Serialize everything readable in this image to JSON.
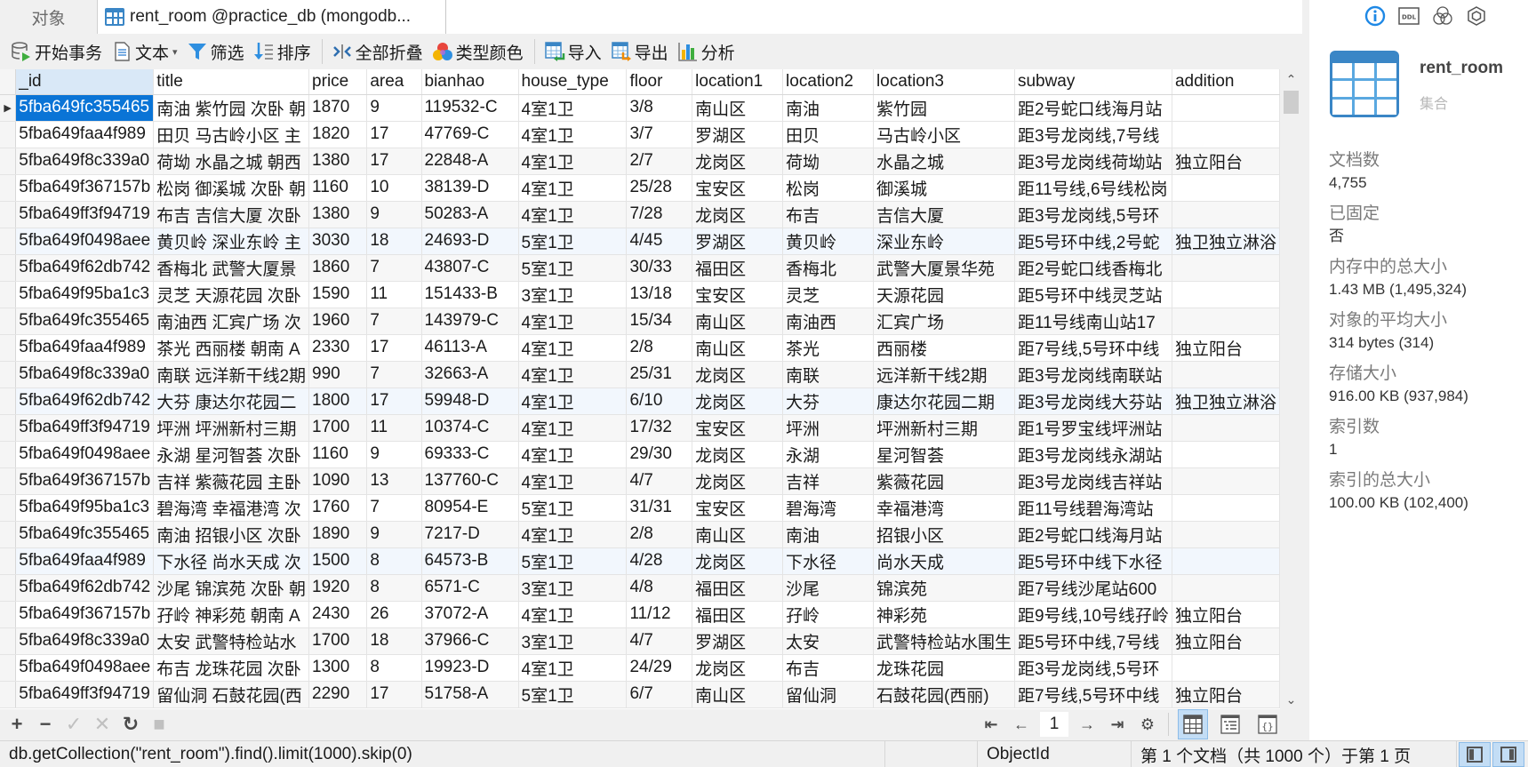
{
  "tabs": {
    "objects_label": "对象",
    "active_label": "rent_room @practice_db (mongodb..."
  },
  "toolbar": {
    "begin_transaction": "开始事务",
    "text": "文本",
    "filter": "筛选",
    "sort": "排序",
    "collapse_all": "全部折叠",
    "type_color": "类型颜色",
    "import": "导入",
    "export": "导出",
    "analyze": "分析"
  },
  "grid": {
    "columns": [
      "_id",
      "title",
      "price",
      "area",
      "bianhao",
      "house_type",
      "floor",
      "location1",
      "location2",
      "location3",
      "subway",
      "addition"
    ],
    "selected_row": 0,
    "rows": [
      [
        "5fba649fc355465",
        "南油 紫竹园 次卧 朝",
        "1870",
        "9",
        "119532-C",
        "4室1卫",
        "3/8",
        "南山区",
        "南油",
        "紫竹园",
        "距2号蛇口线海月站",
        ""
      ],
      [
        "5fba649faa4f989",
        "田贝 马古岭小区 主",
        "1820",
        "17",
        "47769-C",
        "4室1卫",
        "3/7",
        "罗湖区",
        "田贝",
        "马古岭小区",
        "距3号龙岗线,7号线",
        ""
      ],
      [
        "5fba649f8c339a0",
        "荷坳 水晶之城 朝西",
        "1380",
        "17",
        "22848-A",
        "4室1卫",
        "2/7",
        "龙岗区",
        "荷坳",
        "水晶之城",
        "距3号龙岗线荷坳站",
        "独立阳台"
      ],
      [
        "5fba649f367157b",
        "松岗 御溪城 次卧 朝",
        "1160",
        "10",
        "38139-D",
        "4室1卫",
        "25/28",
        "宝安区",
        "松岗",
        "御溪城",
        "距11号线,6号线松岗",
        ""
      ],
      [
        "5fba649ff3f94719",
        "布吉 吉信大厦 次卧",
        "1380",
        "9",
        "50283-A",
        "4室1卫",
        "7/28",
        "龙岗区",
        "布吉",
        "吉信大厦",
        "距3号龙岗线,5号环",
        ""
      ],
      [
        "5fba649f0498aee",
        "黄贝岭 深业东岭 主",
        "3030",
        "18",
        "24693-D",
        "5室1卫",
        "4/45",
        "罗湖区",
        "黄贝岭",
        "深业东岭",
        "距5号环中线,2号蛇",
        "独卫独立淋浴"
      ],
      [
        "5fba649f62db742",
        "香梅北 武警大厦景",
        "1860",
        "7",
        "43807-C",
        "5室1卫",
        "30/33",
        "福田区",
        "香梅北",
        "武警大厦景华苑",
        "距2号蛇口线香梅北",
        ""
      ],
      [
        "5fba649f95ba1c3",
        "灵芝 天源花园 次卧",
        "1590",
        "11",
        "151433-B",
        "3室1卫",
        "13/18",
        "宝安区",
        "灵芝",
        "天源花园",
        "距5号环中线灵芝站",
        ""
      ],
      [
        "5fba649fc355465",
        "南油西 汇宾广场 次",
        "1960",
        "7",
        "143979-C",
        "4室1卫",
        "15/34",
        "南山区",
        "南油西",
        "汇宾广场",
        "距11号线南山站17",
        ""
      ],
      [
        "5fba649faa4f989",
        "茶光 西丽楼 朝南 A",
        "2330",
        "17",
        "46113-A",
        "4室1卫",
        "2/8",
        "南山区",
        "茶光",
        "西丽楼",
        "距7号线,5号环中线",
        "独立阳台"
      ],
      [
        "5fba649f8c339a0",
        "南联 远洋新干线2期",
        "990",
        "7",
        "32663-A",
        "4室1卫",
        "25/31",
        "龙岗区",
        "南联",
        "远洋新干线2期",
        "距3号龙岗线南联站",
        ""
      ],
      [
        "5fba649f62db742",
        "大芬 康达尔花园二",
        "1800",
        "17",
        "59948-D",
        "4室1卫",
        "6/10",
        "龙岗区",
        "大芬",
        "康达尔花园二期",
        "距3号龙岗线大芬站",
        "独卫独立淋浴"
      ],
      [
        "5fba649ff3f94719",
        "坪洲 坪洲新村三期",
        "1700",
        "11",
        "10374-C",
        "4室1卫",
        "17/32",
        "宝安区",
        "坪洲",
        "坪洲新村三期",
        "距1号罗宝线坪洲站",
        ""
      ],
      [
        "5fba649f0498aee",
        "永湖 星河智荟 次卧",
        "1160",
        "9",
        "69333-C",
        "4室1卫",
        "29/30",
        "龙岗区",
        "永湖",
        "星河智荟",
        "距3号龙岗线永湖站",
        ""
      ],
      [
        "5fba649f367157b",
        "吉祥 紫薇花园 主卧",
        "1090",
        "13",
        "137760-C",
        "4室1卫",
        "4/7",
        "龙岗区",
        "吉祥",
        "紫薇花园",
        "距3号龙岗线吉祥站",
        ""
      ],
      [
        "5fba649f95ba1c3",
        "碧海湾 幸福港湾 次",
        "1760",
        "7",
        "80954-E",
        "5室1卫",
        "31/31",
        "宝安区",
        "碧海湾",
        "幸福港湾",
        "距11号线碧海湾站",
        ""
      ],
      [
        "5fba649fc355465",
        "南油 招银小区 次卧",
        "1890",
        "9",
        "7217-D",
        "4室1卫",
        "2/8",
        "南山区",
        "南油",
        "招银小区",
        "距2号蛇口线海月站",
        ""
      ],
      [
        "5fba649faa4f989",
        "下水径 尚水天成 次",
        "1500",
        "8",
        "64573-B",
        "5室1卫",
        "4/28",
        "龙岗区",
        "下水径",
        "尚水天成",
        "距5号环中线下水径",
        ""
      ],
      [
        "5fba649f62db742",
        "沙尾 锦滨苑 次卧 朝",
        "1920",
        "8",
        "6571-C",
        "3室1卫",
        "4/8",
        "福田区",
        "沙尾",
        "锦滨苑",
        "距7号线沙尾站600",
        ""
      ],
      [
        "5fba649f367157b",
        "孖岭 神彩苑 朝南 A",
        "2430",
        "26",
        "37072-A",
        "4室1卫",
        "11/12",
        "福田区",
        "孖岭",
        "神彩苑",
        "距9号线,10号线孖岭",
        "独立阳台"
      ],
      [
        "5fba649f8c339a0",
        "太安 武警特检站水",
        "1700",
        "18",
        "37966-C",
        "3室1卫",
        "4/7",
        "罗湖区",
        "太安",
        "武警特检站水围生",
        "距5号环中线,7号线",
        "独立阳台"
      ],
      [
        "5fba649f0498aee",
        "布吉 龙珠花园 次卧",
        "1300",
        "8",
        "19923-D",
        "4室1卫",
        "24/29",
        "龙岗区",
        "布吉",
        "龙珠花园",
        "距3号龙岗线,5号环",
        ""
      ],
      [
        "5fba649ff3f94719",
        "留仙洞 石鼓花园(西",
        "2290",
        "17",
        "51758-A",
        "5室1卫",
        "6/7",
        "南山区",
        "留仙洞",
        "石鼓花园(西丽)",
        "距7号线,5号环中线",
        "独立阳台"
      ]
    ]
  },
  "pagination": {
    "current_page": "1"
  },
  "statusbar": {
    "query": "db.getCollection(\"rent_room\").find().limit(1000).skip(0)",
    "field_type": "ObjectId",
    "position": "第 1 个文档（共 1000 个）于第 1 页"
  },
  "info_panel": {
    "tab_icons": [
      "info-icon",
      "ddl-icon",
      "venn-icon",
      "hexagon-icon"
    ],
    "collection_name": "rent_room",
    "collection_kind": "集合",
    "stats": [
      {
        "label": "文档数",
        "value": "4,755"
      },
      {
        "label": "已固定",
        "value": "否"
      },
      {
        "label": "内存中的总大小",
        "value": "1.43 MB (1,495,324)"
      },
      {
        "label": "对象的平均大小",
        "value": "314 bytes (314)"
      },
      {
        "label": "存储大小",
        "value": "916.00 KB (937,984)"
      },
      {
        "label": "索引数",
        "value": "1"
      },
      {
        "label": "索引的总大小",
        "value": "100.00 KB (102,400)"
      }
    ]
  },
  "colors": {
    "accent": "#0a74d6",
    "selected_header": "#d9e8f7",
    "info_icon": "#1e88e5",
    "collection_icon": "#3a86c6"
  }
}
